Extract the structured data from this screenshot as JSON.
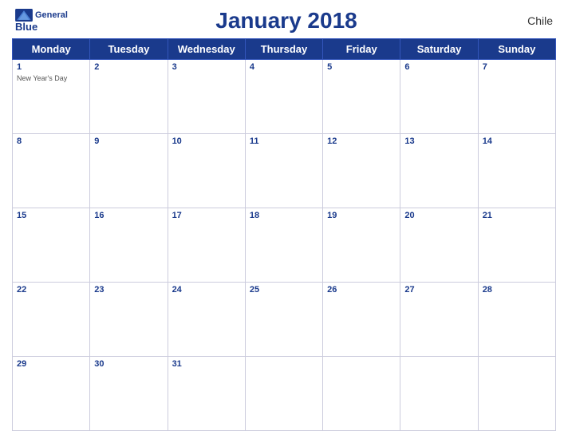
{
  "header": {
    "logo_general": "General",
    "logo_blue": "Blue",
    "title": "January 2018",
    "country": "Chile"
  },
  "days_of_week": [
    "Monday",
    "Tuesday",
    "Wednesday",
    "Thursday",
    "Friday",
    "Saturday",
    "Sunday"
  ],
  "weeks": [
    [
      {
        "day": "1",
        "holiday": "New Year's Day"
      },
      {
        "day": "2",
        "holiday": ""
      },
      {
        "day": "3",
        "holiday": ""
      },
      {
        "day": "4",
        "holiday": ""
      },
      {
        "day": "5",
        "holiday": ""
      },
      {
        "day": "6",
        "holiday": ""
      },
      {
        "day": "7",
        "holiday": ""
      }
    ],
    [
      {
        "day": "8",
        "holiday": ""
      },
      {
        "day": "9",
        "holiday": ""
      },
      {
        "day": "10",
        "holiday": ""
      },
      {
        "day": "11",
        "holiday": ""
      },
      {
        "day": "12",
        "holiday": ""
      },
      {
        "day": "13",
        "holiday": ""
      },
      {
        "day": "14",
        "holiday": ""
      }
    ],
    [
      {
        "day": "15",
        "holiday": ""
      },
      {
        "day": "16",
        "holiday": ""
      },
      {
        "day": "17",
        "holiday": ""
      },
      {
        "day": "18",
        "holiday": ""
      },
      {
        "day": "19",
        "holiday": ""
      },
      {
        "day": "20",
        "holiday": ""
      },
      {
        "day": "21",
        "holiday": ""
      }
    ],
    [
      {
        "day": "22",
        "holiday": ""
      },
      {
        "day": "23",
        "holiday": ""
      },
      {
        "day": "24",
        "holiday": ""
      },
      {
        "day": "25",
        "holiday": ""
      },
      {
        "day": "26",
        "holiday": ""
      },
      {
        "day": "27",
        "holiday": ""
      },
      {
        "day": "28",
        "holiday": ""
      }
    ],
    [
      {
        "day": "29",
        "holiday": ""
      },
      {
        "day": "30",
        "holiday": ""
      },
      {
        "day": "31",
        "holiday": ""
      },
      {
        "day": "",
        "holiday": ""
      },
      {
        "day": "",
        "holiday": ""
      },
      {
        "day": "",
        "holiday": ""
      },
      {
        "day": "",
        "holiday": ""
      }
    ]
  ]
}
